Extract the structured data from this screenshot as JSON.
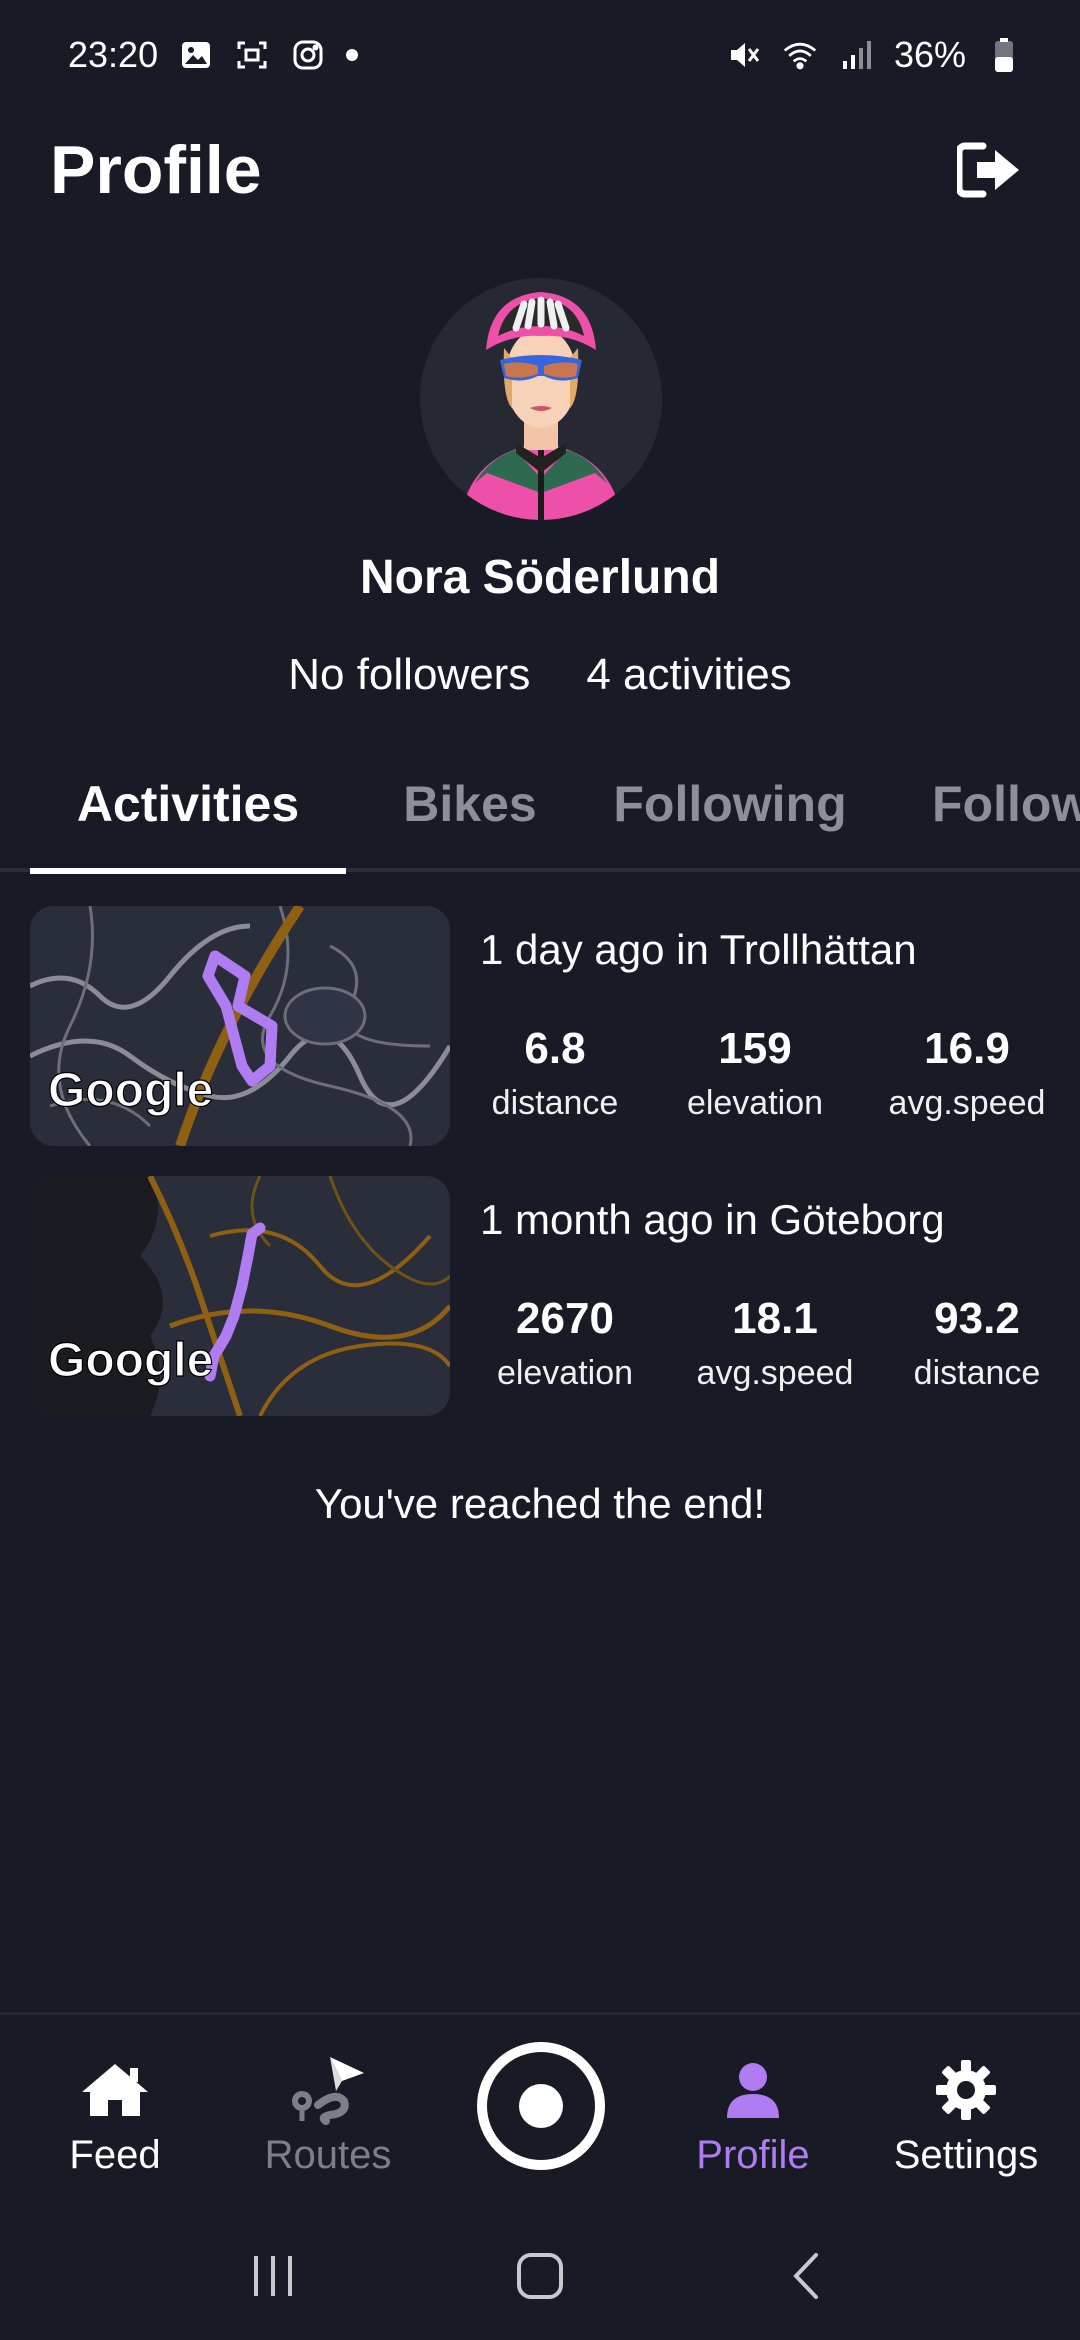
{
  "status_bar": {
    "time": "23:20",
    "battery": "36%",
    "icons": [
      "image-icon",
      "screenshot-icon",
      "instagram-icon",
      "dot-icon",
      "mute-icon",
      "wifi-icon",
      "signal-icon",
      "battery-icon"
    ]
  },
  "header": {
    "title": "Profile",
    "logout_icon": "logout-icon"
  },
  "profile": {
    "name": "Nora Söderlund",
    "followers": "No followers",
    "activities": "4 activities"
  },
  "tabs": [
    {
      "label": "Activities",
      "active": true
    },
    {
      "label": "Bikes",
      "active": false
    },
    {
      "label": "Following",
      "active": false
    },
    {
      "label": "Followers",
      "active": false
    }
  ],
  "activities": [
    {
      "title": "1 day ago in Trollhättan",
      "map_label": "Google",
      "stats": [
        {
          "value": "6.8",
          "label": "distance"
        },
        {
          "value": "159",
          "label": "elevation"
        },
        {
          "value": "16.9",
          "label": "avg.speed"
        }
      ]
    },
    {
      "title": "1 month ago in Göteborg",
      "map_label": "Google",
      "stats": [
        {
          "value": "2670",
          "label": "elevation"
        },
        {
          "value": "18.1",
          "label": "avg.speed"
        },
        {
          "value": "93.2",
          "label": "distance"
        }
      ]
    }
  ],
  "end_message": "You've reached the end!",
  "bottom_nav": [
    {
      "label": "Feed",
      "icon": "home-icon",
      "state": "normal"
    },
    {
      "label": "Routes",
      "icon": "routes-icon",
      "state": "disabled"
    },
    {
      "label": "Profile",
      "icon": "person-icon",
      "state": "active"
    },
    {
      "label": "Settings",
      "icon": "gear-icon",
      "state": "normal"
    }
  ],
  "colors": {
    "background": "#181a25",
    "accent": "#b07cf2",
    "disabled": "#7d7f88",
    "route": "#b07cf2"
  }
}
